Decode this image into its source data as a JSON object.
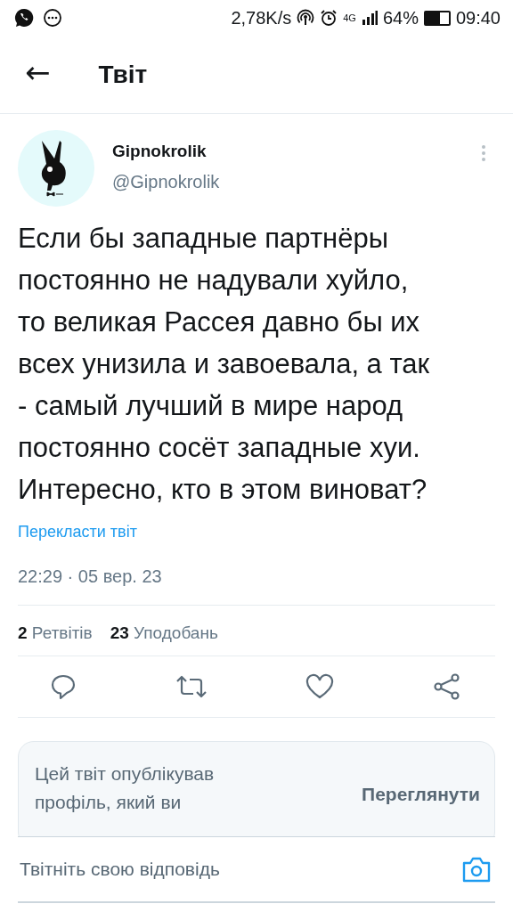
{
  "status_bar": {
    "speed": "2,78K/s",
    "network": "4G",
    "battery": "64%",
    "time": "09:40"
  },
  "header": {
    "back": "←",
    "title": "Твіт"
  },
  "tweet": {
    "name": "Gipnokrolik",
    "handle": "@Gipnokrolik",
    "text": "Если бы западные партнёры постоянно не надували хуйло, то великая Рассея давно бы их всех унизила и завоевала, а так - самый лучший в мире народ постоянно сосёт западные хуи. Интересно, кто в этом виноват?",
    "translate": "Перекласти твіт",
    "timestamp": "22:29 · 05 вер. 23",
    "stats": [
      {
        "count": "2",
        "label": "Ретвітів"
      },
      {
        "count": "23",
        "label": "Уподобань"
      }
    ]
  },
  "notice": {
    "text": "Цей твіт опублікував профіль, який ви",
    "button": "Переглянути"
  },
  "reply": {
    "placeholder": "Твітніть свою відповідь"
  }
}
